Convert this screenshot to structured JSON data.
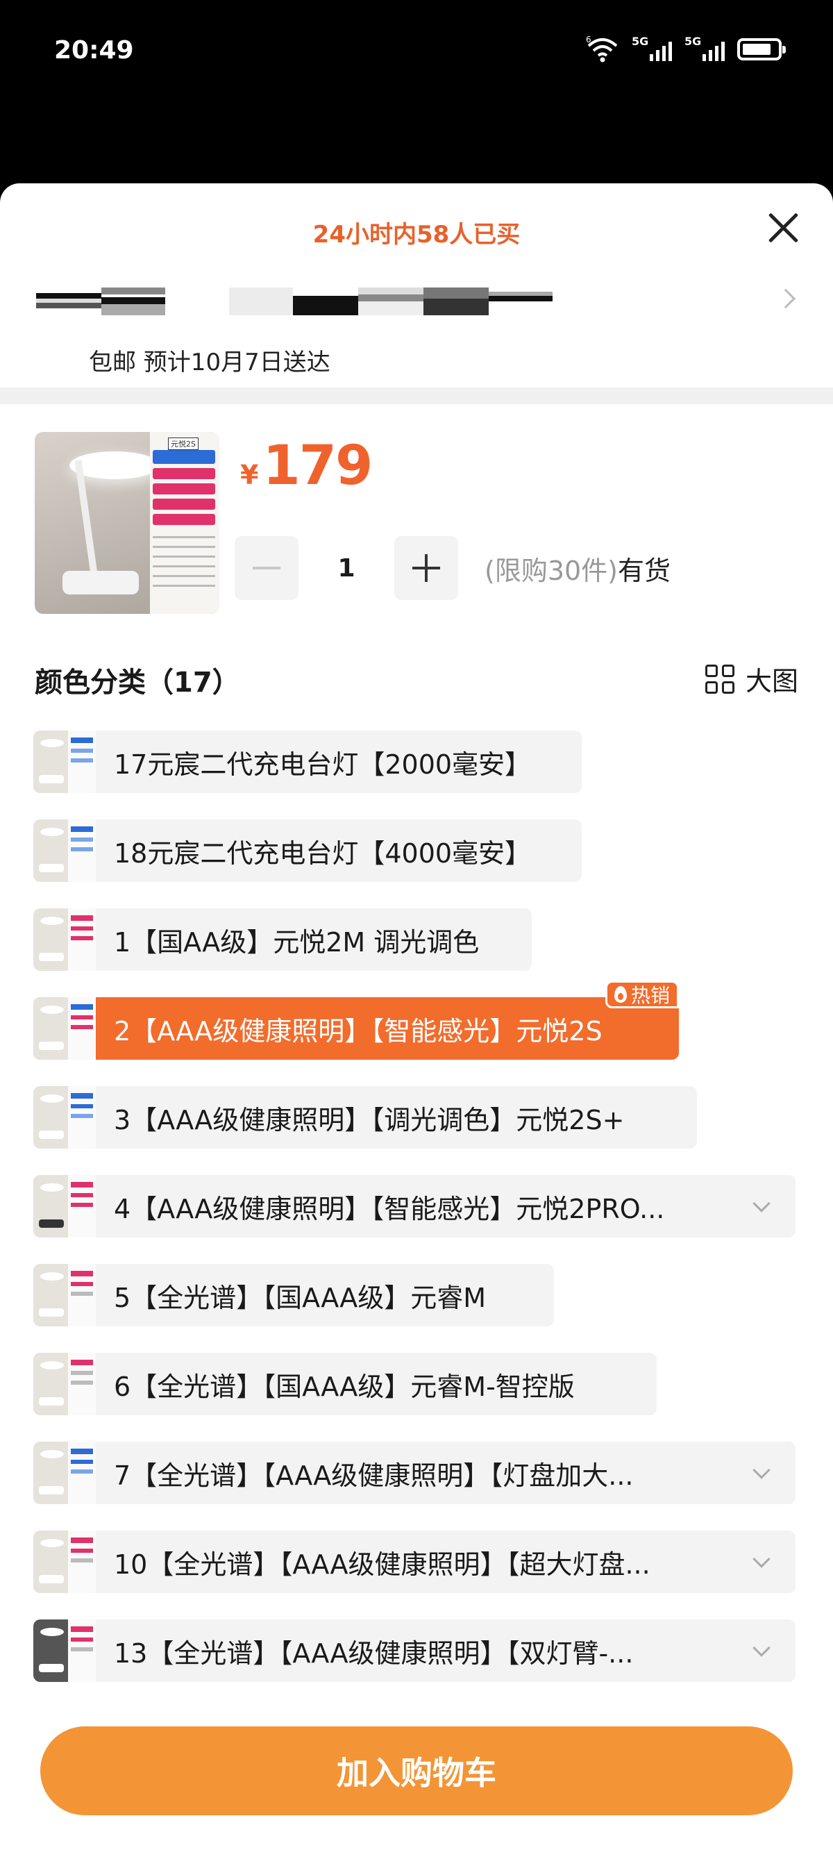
{
  "status_bar": {
    "time": "20:49",
    "sim1": "5G",
    "sim2": "5G",
    "wifi_tag": "6"
  },
  "header": {
    "note": "24小时内58人已买"
  },
  "delivery": {
    "text": "包邮 预计10月7日送达"
  },
  "product": {
    "currency": "¥",
    "price": "179",
    "thumb_badge": "元悦2S",
    "quantity": "1",
    "limit_text": "(限购30件)",
    "stock_text": "有货"
  },
  "section": {
    "title": "颜色分类（17）",
    "big_image_label": "大图"
  },
  "options": [
    {
      "label": "17元宸二代充电台灯【2000毫安】"
    },
    {
      "label": "18元宸二代充电台灯【4000毫安】"
    },
    {
      "label": "1【国AA级】元悦2M 调光调色"
    },
    {
      "label": "2【AAA级健康照明】【智能感光】元悦2S",
      "hot": "热销"
    },
    {
      "label": "3【AAA级健康照明】【调光调色】元悦2S+"
    },
    {
      "label": "4【AAA级健康照明】【智能感光】元悦2PRO..."
    },
    {
      "label": "5【全光谱】【国AAA级】元睿M"
    },
    {
      "label": "6【全光谱】【国AAA级】元睿M-智控版"
    },
    {
      "label": "7【全光谱】【AAA级健康照明】【灯盘加大..."
    },
    {
      "label": "10【全光谱】【AAA级健康照明】【超大灯盘..."
    },
    {
      "label": "13【全光谱】【AAA级健康照明】【双灯臂-..."
    }
  ],
  "cart": {
    "label": "加入购物车"
  },
  "colors": {
    "accent": "#f26c2c",
    "price": "#f0622b",
    "cart": "#f39536"
  }
}
